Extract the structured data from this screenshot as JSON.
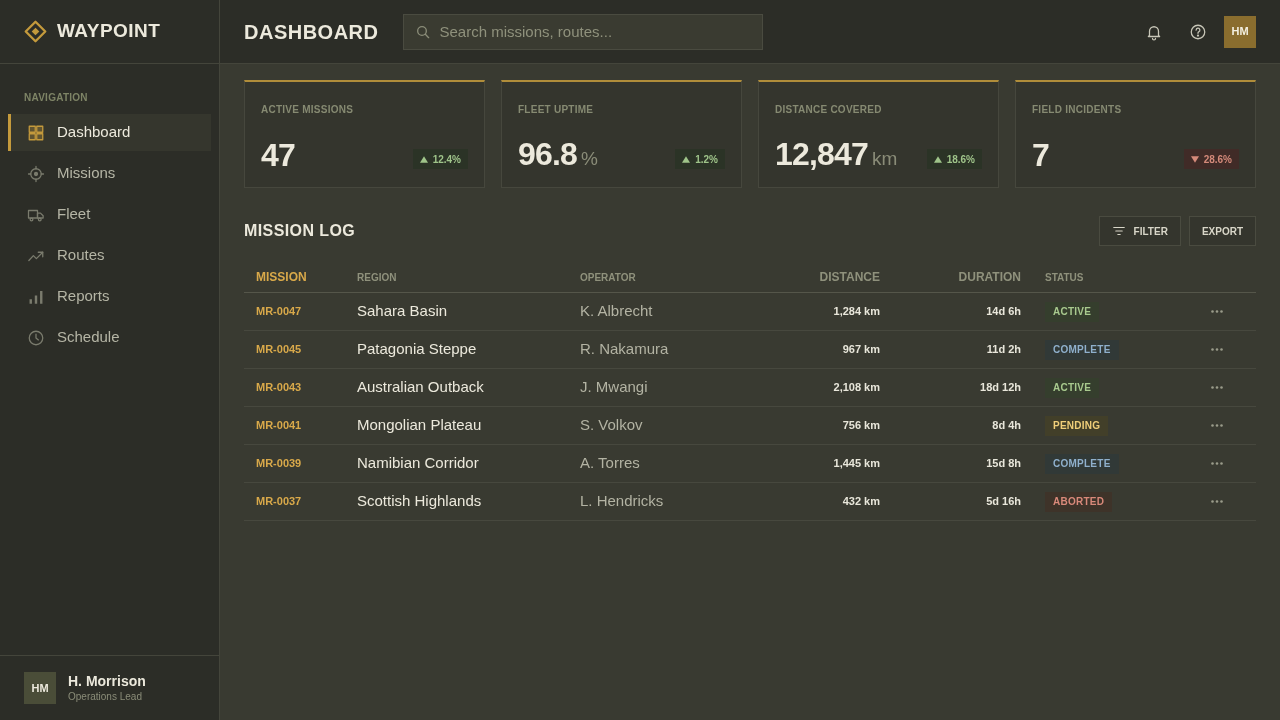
{
  "sidebar": {
    "logo": "WAYPOINT",
    "section_label": "NAVIGATION",
    "items": [
      {
        "label": "Dashboard",
        "selected": true
      },
      {
        "label": "Missions",
        "selected": false
      },
      {
        "label": "Fleet",
        "selected": false
      },
      {
        "label": "Routes",
        "selected": false
      },
      {
        "label": "Reports",
        "selected": false
      },
      {
        "label": "Schedule",
        "selected": false
      }
    ],
    "user": {
      "initials": "HM",
      "name": "H. Morrison",
      "role": "Operations Lead"
    }
  },
  "header": {
    "title": "DASHBOARD",
    "search": {
      "placeholder": "Search missions, routes..."
    },
    "avatar_initials": "HM"
  },
  "kpis": [
    {
      "label": "ACTIVE MISSIONS",
      "value": "47",
      "delta": "12.4%",
      "rising": true
    },
    {
      "label": "FLEET UPTIME",
      "value": "96.8",
      "unit": "%",
      "delta": "1.2%",
      "rising": true
    },
    {
      "label": "DISTANCE COVERED",
      "value": "12,847",
      "unit": "km",
      "delta": "18.6%",
      "rising": true
    },
    {
      "label": "FIELD INCIDENTS",
      "value": "7",
      "delta": "28.6%",
      "rising": false
    }
  ],
  "mission_log": {
    "title": "MISSION LOG",
    "buttons": [
      "FILTER",
      "EXPORT"
    ],
    "table": {
      "columns": [
        {
          "label": "MISSION",
          "numeric": false,
          "sorted": true
        },
        {
          "label": "REGION",
          "numeric": false,
          "sorted": false
        },
        {
          "label": "OPERATOR",
          "numeric": false,
          "sorted": false
        },
        {
          "label": "DISTANCE",
          "numeric": true,
          "sorted": false
        },
        {
          "label": "DURATION",
          "numeric": true,
          "sorted": false
        },
        {
          "label": "STATUS",
          "numeric": false,
          "sorted": false
        }
      ],
      "rows": [
        {
          "mission": "MR-0047",
          "region": "Sahara Basin",
          "operator": "K. Albrecht",
          "distance": "1,284 km",
          "duration": "14d 6h",
          "status": {
            "label": "ACTIVE",
            "color": "#a8c98e"
          }
        },
        {
          "mission": "MR-0045",
          "region": "Patagonia Steppe",
          "operator": "R. Nakamura",
          "distance": "967 km",
          "duration": "11d 2h",
          "status": {
            "label": "COMPLETE",
            "color": "#8fb0cc"
          }
        },
        {
          "mission": "MR-0043",
          "region": "Australian Outback",
          "operator": "J. Mwangi",
          "distance": "2,108 km",
          "duration": "18d 12h",
          "status": {
            "label": "ACTIVE",
            "color": "#a8c98e"
          }
        },
        {
          "mission": "MR-0041",
          "region": "Mongolian Plateau",
          "operator": "S. Volkov",
          "distance": "756 km",
          "duration": "8d 4h",
          "status": {
            "label": "PENDING",
            "color": "#f0cf7a"
          }
        },
        {
          "mission": "MR-0039",
          "region": "Namibian Corridor",
          "operator": "A. Torres",
          "distance": "1,445 km",
          "duration": "15d 8h",
          "status": {
            "label": "COMPLETE",
            "color": "#8fb0cc"
          }
        },
        {
          "mission": "MR-0037",
          "region": "Scottish Highlands",
          "operator": "L. Hendricks",
          "distance": "432 km",
          "duration": "5d 16h",
          "status": {
            "label": "ABORTED",
            "color": "#d9897a"
          }
        }
      ]
    }
  }
}
